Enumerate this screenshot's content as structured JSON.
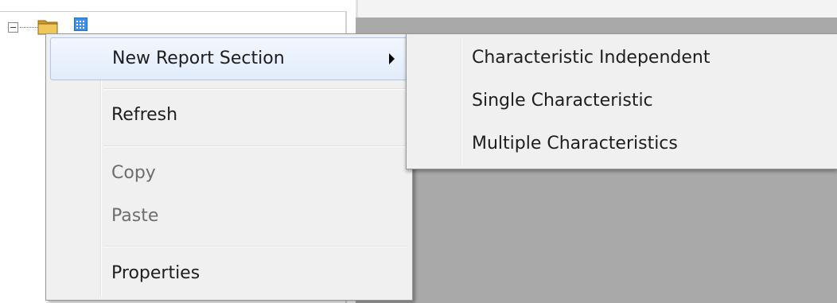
{
  "context_menu": {
    "items": [
      {
        "label": "New Report Section",
        "disabled": false,
        "highlighted": true,
        "has_submenu": true
      },
      {
        "label": "Refresh",
        "disabled": false
      },
      {
        "label": "Copy",
        "disabled": true
      },
      {
        "label": "Paste",
        "disabled": true
      },
      {
        "label": "Properties",
        "disabled": false
      }
    ]
  },
  "submenu": {
    "items": [
      {
        "label": "Characteristic Independent"
      },
      {
        "label": "Single Characteristic"
      },
      {
        "label": "Multiple Characteristics"
      }
    ]
  },
  "colors": {
    "highlight_border": "#a9c7ef",
    "menu_background": "#f0f0f0",
    "disabled_text": "#6d6d6d",
    "workspace_gray": "#a9a9a9"
  },
  "icons": {
    "expander": "collapse-minus-icon",
    "folder": "folder-icon",
    "grid": "grid-icon",
    "submenu_arrow": "chevron-right-icon"
  }
}
